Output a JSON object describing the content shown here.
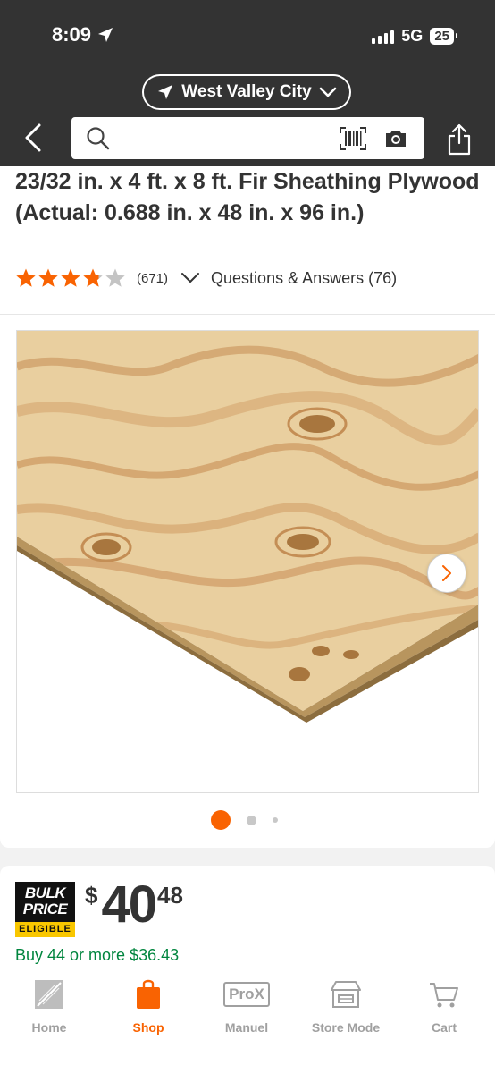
{
  "status_bar": {
    "time": "8:09",
    "network": "5G",
    "battery": "25"
  },
  "header": {
    "location": "West Valley City",
    "search": {
      "placeholder": ""
    }
  },
  "product": {
    "title": "23/32 in. x 4 ft. x 8 ft. Fir Sheathing Plywood (Actual: 0.688 in. x 48 in. x 96 in.)",
    "rating": 3.8,
    "review_count": "(671)",
    "qa_label": "Questions & Answers (76)",
    "gallery": {
      "image_count": 3,
      "active_index": 0
    }
  },
  "pricing": {
    "badge": {
      "line1": "BULK",
      "line2": "PRICE",
      "line3": "ELIGIBLE"
    },
    "currency": "$",
    "dollars": "40",
    "cents": "48",
    "bulk_offer": "Buy 44 or more $36.43"
  },
  "tabbar": {
    "items": [
      {
        "label": "Home",
        "icon": "home-depot-logo-icon"
      },
      {
        "label": "Shop",
        "icon": "shopping-bag-icon"
      },
      {
        "label": "Manuel",
        "icon": "prox-icon",
        "icon_text": "ProX"
      },
      {
        "label": "Store Mode",
        "icon": "store-icon"
      },
      {
        "label": "Cart",
        "icon": "cart-icon"
      }
    ],
    "active": "Shop"
  },
  "colors": {
    "brand_orange": "#f96302",
    "header_bg": "#333333",
    "star": "#f96302",
    "promo_green": "#00853e",
    "badge_yellow": "#f9c700"
  }
}
